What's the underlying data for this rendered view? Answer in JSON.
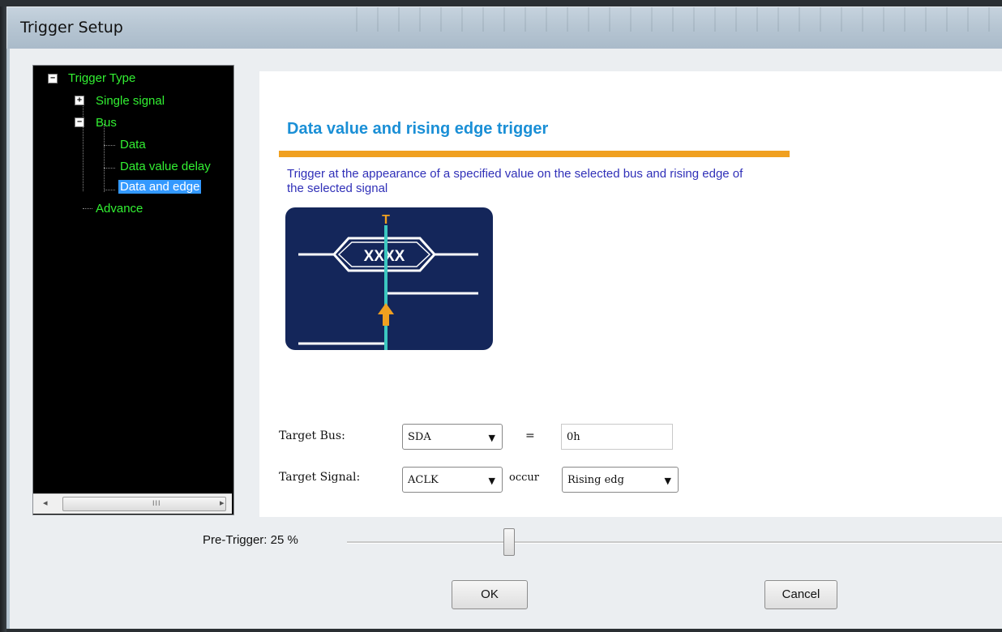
{
  "window": {
    "title": "Trigger Setup"
  },
  "tree": {
    "items": [
      {
        "label": "Trigger Type",
        "expander": "−"
      },
      {
        "label": "Single signal",
        "expander": "+"
      },
      {
        "label": "Bus",
        "expander": "−"
      },
      {
        "label": "Data"
      },
      {
        "label": "Data value delay"
      },
      {
        "label": "Data and edge",
        "selected": true
      },
      {
        "label": "Advance"
      }
    ],
    "scroll_left": "◂",
    "scroll_right": "▸",
    "scroll_grip": "III"
  },
  "content": {
    "heading": "Data value and rising edge trigger",
    "description": "Trigger at the appearance of a specified value on the selected bus and rising edge of the selected signal",
    "diagram": {
      "marker": "T",
      "bus_value": "XXXX"
    }
  },
  "form": {
    "target_bus_label": "Target Bus:",
    "target_bus_value": "SDA",
    "equals": "=",
    "bus_data_value": "0h",
    "target_signal_label": "Target Signal:",
    "target_signal_value": "ACLK",
    "occur_label": "occur",
    "edge_value": "Rising edg"
  },
  "pre_trigger": {
    "label": "Pre-Trigger: 25 %",
    "value_percent": 25
  },
  "buttons": {
    "ok": "OK",
    "cancel": "Cancel"
  },
  "colors": {
    "tree_text": "#32f032",
    "heading": "#1a8fd6",
    "rule": "#f0a020",
    "description": "#3030b8",
    "diagram_bg": "#14265a",
    "diagram_accent": "#f0a020",
    "diagram_cursor": "#3cc8c0"
  }
}
